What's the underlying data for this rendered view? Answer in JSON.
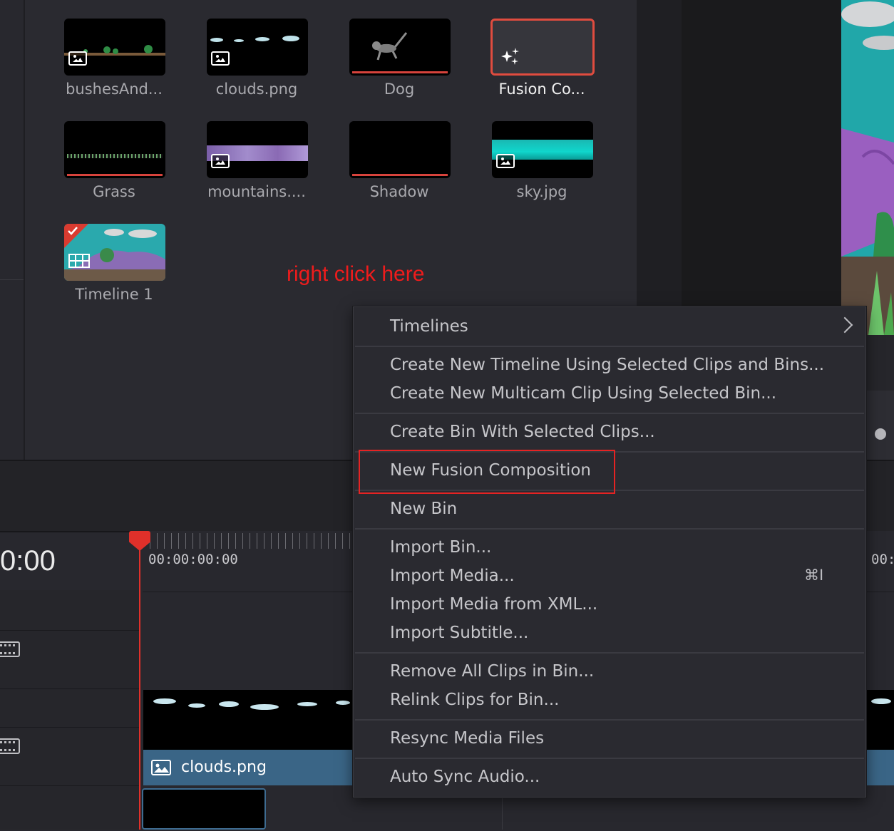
{
  "media_pool": {
    "clips": [
      {
        "name": "bushesAnd...",
        "selected": false
      },
      {
        "name": "clouds.png",
        "selected": false
      },
      {
        "name": "Dog",
        "selected": false
      },
      {
        "name": "Fusion Co...",
        "selected": true
      },
      {
        "name": "Grass",
        "selected": false
      },
      {
        "name": "mountains....",
        "selected": false
      },
      {
        "name": "Shadow",
        "selected": false
      },
      {
        "name": "sky.jpg",
        "selected": false
      },
      {
        "name": "Timeline 1",
        "selected": false
      }
    ],
    "annotation": "right click here"
  },
  "timeline": {
    "timecode": "0:00",
    "ruler_start": "00:00:00:00",
    "ruler_right": "00:",
    "clip_name": "clouds.png"
  },
  "context_menu": {
    "items": [
      "Timelines",
      "Create New Timeline Using Selected Clips and Bins...",
      "Create New Multicam Clip Using Selected Bin...",
      "Create Bin With Selected Clips...",
      "New Fusion Composition",
      "New Bin",
      "Import Bin...",
      "Import Media...",
      "Import Media from XML...",
      "Import Subtitle...",
      "Remove All Clips in Bin...",
      "Relink Clips for Bin...",
      "Resync Media Files",
      "Auto Sync Audio..."
    ],
    "import_media_shortcut": "⌘I",
    "highlighted_item": "New Fusion Composition"
  },
  "colors": {
    "highlight_red": "#e52323",
    "selected_clip_border": "#e04c3f",
    "clip_bar_blue": "#3a6586",
    "playhead_red": "#e0302a"
  }
}
